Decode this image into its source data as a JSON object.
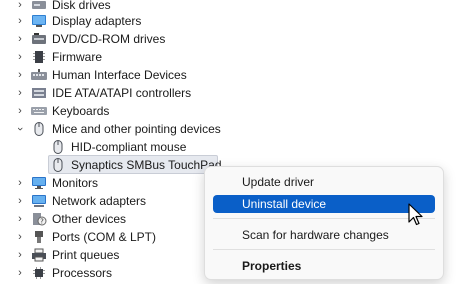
{
  "tree": [
    {
      "label": "Disk drives",
      "icon": "disk-drive-icon",
      "expanded": false
    },
    {
      "label": "Display adapters",
      "icon": "display-adapter-icon",
      "expanded": false
    },
    {
      "label": "DVD/CD-ROM drives",
      "icon": "dvd-drive-icon",
      "expanded": false
    },
    {
      "label": "Firmware",
      "icon": "firmware-icon",
      "expanded": false
    },
    {
      "label": "Human Interface Devices",
      "icon": "hid-icon",
      "expanded": false
    },
    {
      "label": "IDE ATA/ATAPI controllers",
      "icon": "ide-controller-icon",
      "expanded": false
    },
    {
      "label": "Keyboards",
      "icon": "keyboard-icon",
      "expanded": false
    },
    {
      "label": "Mice and other pointing devices",
      "icon": "mouse-icon",
      "expanded": true
    },
    {
      "label": "HID-compliant mouse",
      "icon": "mouse-icon",
      "child": true
    },
    {
      "label": "Synaptics SMBus TouchPad",
      "icon": "mouse-icon",
      "child": true,
      "selected": true
    },
    {
      "label": "Monitors",
      "icon": "monitor-icon",
      "expanded": false
    },
    {
      "label": "Network adapters",
      "icon": "network-adapter-icon",
      "expanded": false
    },
    {
      "label": "Other devices",
      "icon": "other-devices-icon",
      "expanded": false
    },
    {
      "label": "Ports (COM & LPT)",
      "icon": "ports-icon",
      "expanded": false
    },
    {
      "label": "Print queues",
      "icon": "printer-icon",
      "expanded": false
    },
    {
      "label": "Processors",
      "icon": "processor-icon",
      "expanded": false
    }
  ],
  "context_menu": {
    "update": "Update driver",
    "uninstall": "Uninstall device",
    "scan": "Scan for hardware changes",
    "properties": "Properties"
  },
  "colors": {
    "menu_highlight": "#0a5fc8",
    "selection": "#e6e9ef"
  }
}
